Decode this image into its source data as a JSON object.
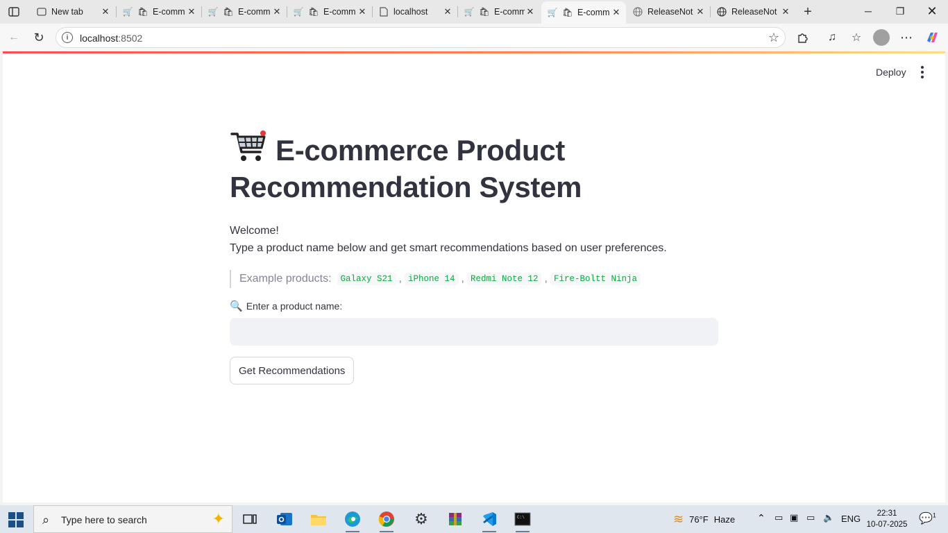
{
  "browser": {
    "tabs": [
      {
        "title": "New tab",
        "icon": "newtab-icon",
        "active": false
      },
      {
        "title": "E-comm",
        "icon": "cart-icon",
        "active": false
      },
      {
        "title": "E-comm",
        "icon": "cart-icon",
        "active": false
      },
      {
        "title": "E-comm",
        "icon": "cart-icon",
        "active": false
      },
      {
        "title": "localhost",
        "icon": "page-icon",
        "active": false
      },
      {
        "title": "E-comm",
        "icon": "cart-icon",
        "active": false
      },
      {
        "title": "E-comm",
        "icon": "cart-icon",
        "active": true
      },
      {
        "title": "ReleaseNot",
        "icon": "globe-icon",
        "active": false
      },
      {
        "title": "ReleaseNot",
        "icon": "globe-icon",
        "active": false
      }
    ],
    "address": {
      "host": "localhost",
      "port": ":8502"
    }
  },
  "app": {
    "deploy_label": "Deploy",
    "title_emoji": "shopping-cart-icon",
    "title": "E-commerce Product Recommendation System",
    "welcome_line1": "Welcome!",
    "welcome_line2": "Type a product name below and get smart recommendations based on user preferences.",
    "examples_label": "Example products:",
    "examples": [
      "Galaxy S21",
      "iPhone 14",
      "Redmi Note 12",
      "Fire-Boltt Ninja"
    ],
    "input_label": "Enter a product name:",
    "input_value": "",
    "button_label": "Get Recommendations"
  },
  "taskbar": {
    "search_placeholder": "Type here to search",
    "weather_temp": "76°F",
    "weather_desc": "Haze",
    "language": "ENG",
    "time": "22:31",
    "date": "10-07-2025",
    "notification_count": "1"
  }
}
